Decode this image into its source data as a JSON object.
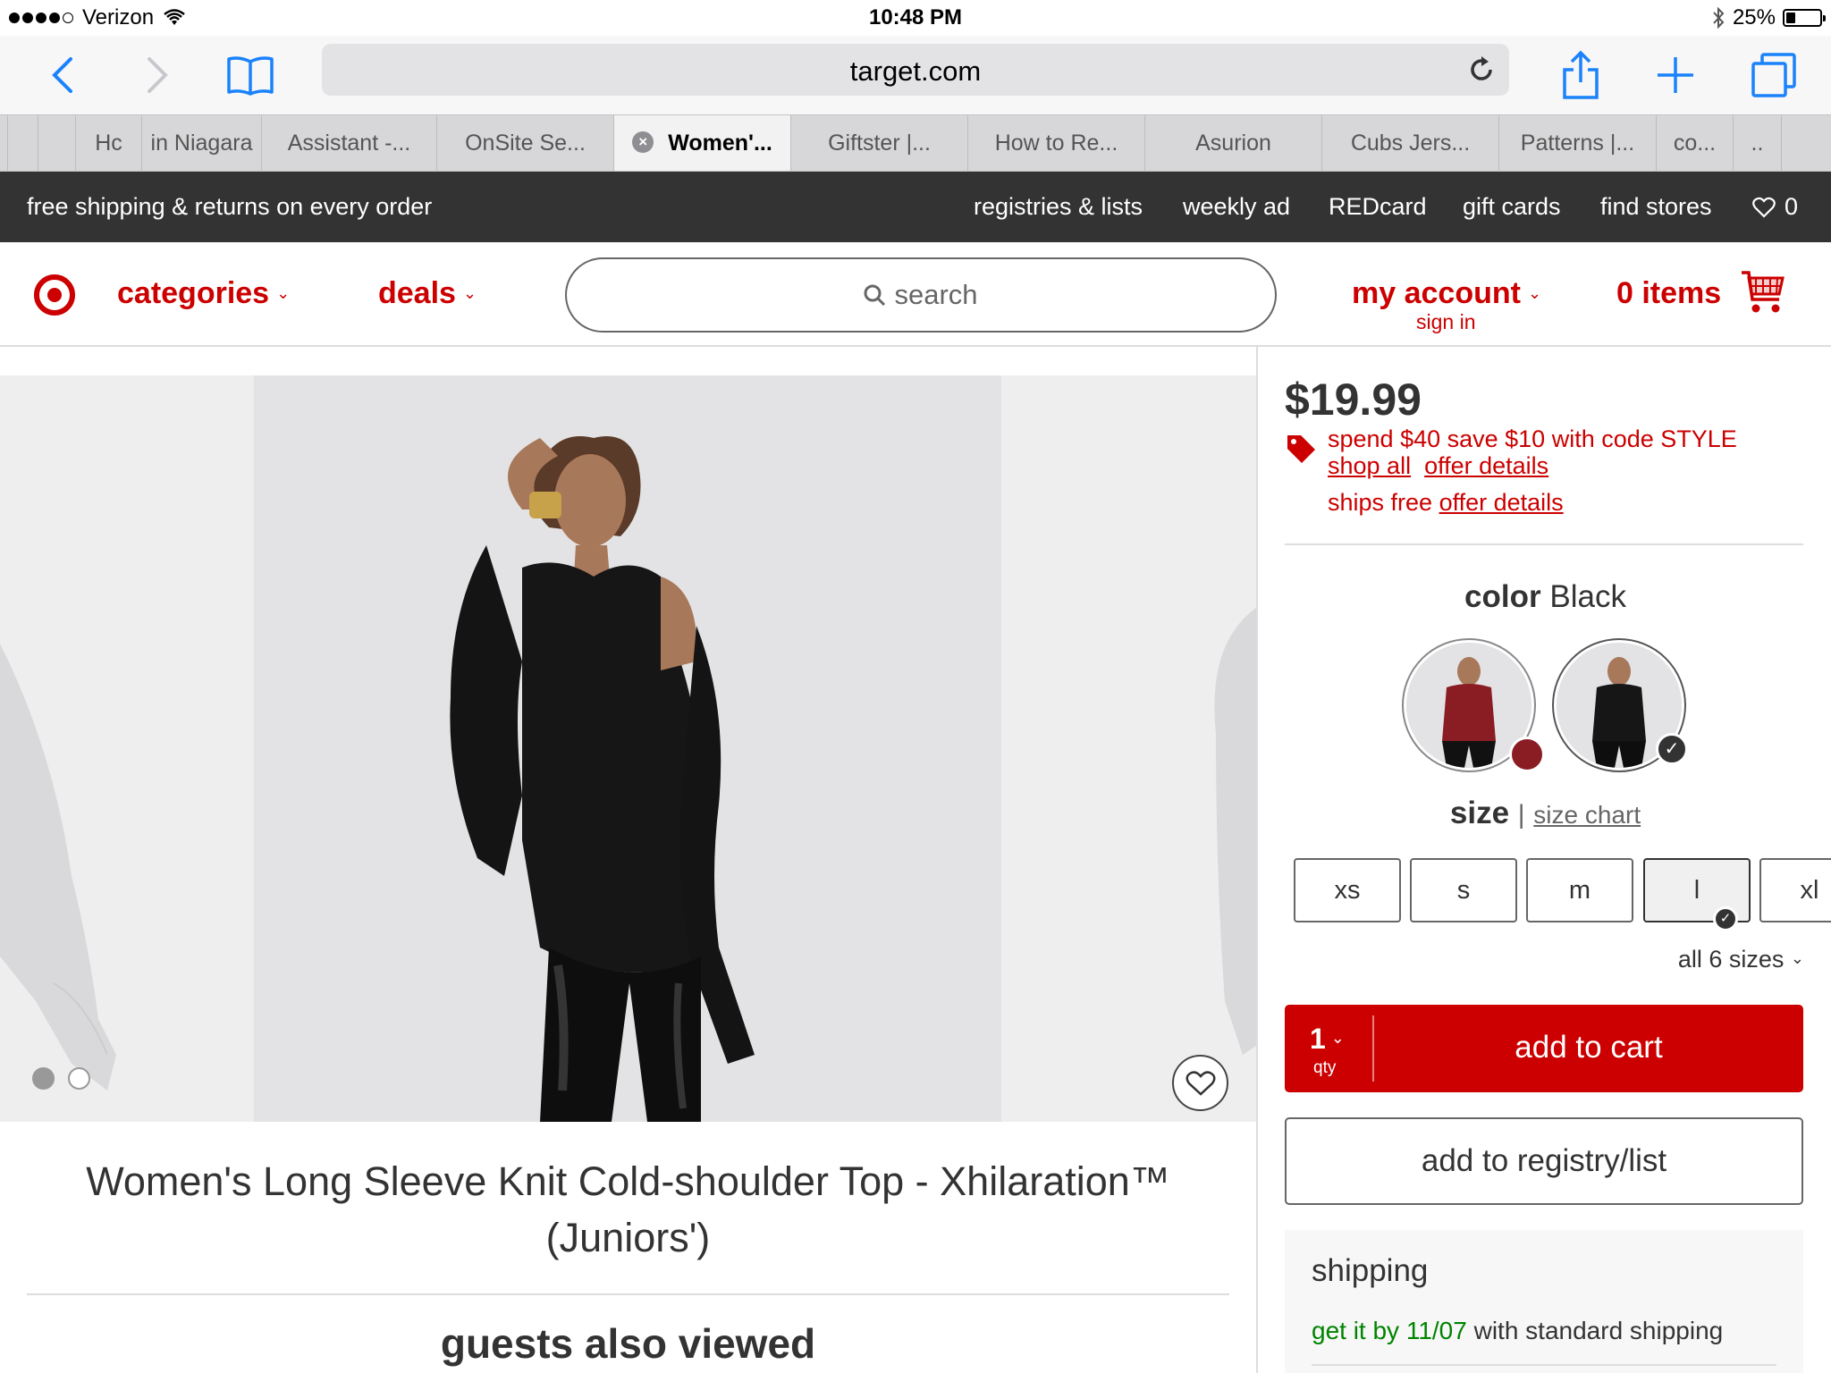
{
  "status_bar": {
    "carrier": "Verizon",
    "time": "10:48 PM",
    "battery": "25%"
  },
  "browser": {
    "url": "target.com",
    "tabs": [
      {
        "label": "Hc"
      },
      {
        "label": "in Niagara"
      },
      {
        "label": "Assistant -..."
      },
      {
        "label": "OnSite Se..."
      },
      {
        "label": "Women'..."
      },
      {
        "label": "Giftster |..."
      },
      {
        "label": "How to Re..."
      },
      {
        "label": "Asurion"
      },
      {
        "label": "Cubs Jers..."
      },
      {
        "label": "Patterns |..."
      },
      {
        "label": "co..."
      },
      {
        "label": ".."
      }
    ]
  },
  "promo_bar": {
    "text": "free shipping & returns on every order",
    "links": [
      "registries & lists",
      "weekly ad",
      "REDcard",
      "gift cards",
      "find stores"
    ],
    "favorites_count": "0"
  },
  "header": {
    "categories": "categories",
    "deals": "deals",
    "search_placeholder": "search",
    "account": "my account",
    "sign_in": "sign in",
    "cart": "0 items"
  },
  "product": {
    "title": "Women's Long Sleeve Knit Cold-shoulder Top - Xhilaration™ (Juniors')",
    "price": "$19.99",
    "promo": "spend $40 save $10 with code STYLE",
    "shop_all": "shop all",
    "offer_details": "offer details",
    "ships_free": "ships free",
    "color_label": "color",
    "color_value": "Black",
    "size_label": "size",
    "size_chart": "size chart",
    "sizes": [
      "xs",
      "s",
      "m",
      "l",
      "xl"
    ],
    "selected_size": "l",
    "all_sizes": "all 6 sizes",
    "qty": "1",
    "qty_label": "qty",
    "add_to_cart": "add to cart",
    "add_to_registry": "add to registry/list",
    "shipping_title": "shipping",
    "shipping_date_prefix": "get it by 11/07",
    "shipping_date_suffix": "with standard shipping"
  },
  "guests_heading": "guests also viewed",
  "colors": {
    "brand_red": "#cc0000",
    "dark_bar": "#333333",
    "ios_blue": "#1a82fb"
  }
}
